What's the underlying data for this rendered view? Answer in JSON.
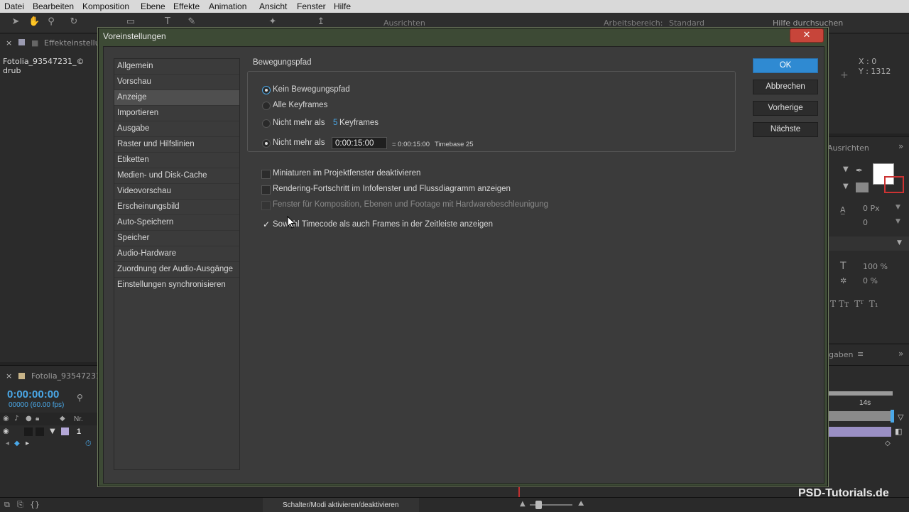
{
  "menubar": {
    "items": [
      "Datei",
      "Bearbeiten",
      "Komposition",
      "Ebene",
      "Effekte",
      "Animation",
      "Ansicht",
      "Fenster",
      "Hilfe"
    ]
  },
  "toolbar": {
    "align_label": "Ausrichten",
    "workspace_label": "Arbeitsbereich:",
    "workspace_value": "Standard",
    "search_placeholder": "Hilfe durchsuchen"
  },
  "background": {
    "effects_tab": "Effekteinstellu",
    "project_file": "Fotolia_93547231_© drub",
    "info_x": "X : 0",
    "info_y": "Y : 1312",
    "align_tab": "Ausrichten",
    "text_values": [
      "0 Px",
      "0",
      "100 %",
      "0 %"
    ],
    "tab_partial": "gaben",
    "timeline_tab": "Fotolia_93547231",
    "timecode": "0:00:00:00",
    "fps": "00000 (60.00 fps)",
    "col_nr": "Nr.",
    "layer_num": "1",
    "ruler_label": "14s",
    "switch_label": "Schalter/Modi aktivieren/deaktivieren",
    "watermark": "PSD-Tutorials.de"
  },
  "dialog": {
    "title": "Voreinstellungen",
    "close_glyph": "✕",
    "sidebar": [
      {
        "label": "Allgemein"
      },
      {
        "label": "Vorschau"
      },
      {
        "label": "Anzeige"
      },
      {
        "label": "Importieren"
      },
      {
        "label": "Ausgabe"
      },
      {
        "label": "Raster und Hilfslinien"
      },
      {
        "label": "Etiketten"
      },
      {
        "label": "Medien- und Disk-Cache"
      },
      {
        "label": "Videovorschau"
      },
      {
        "label": "Erscheinungsbild"
      },
      {
        "label": "Auto-Speichern"
      },
      {
        "label": "Speicher"
      },
      {
        "label": "Audio-Hardware"
      },
      {
        "label": "Zuordnung der Audio-Ausgänge"
      },
      {
        "label": "Einstellungen synchronisieren"
      }
    ],
    "active_index": 2,
    "motion_path": {
      "title": "Bewegungspfad",
      "options": {
        "none": "Kein Bewegungspfad",
        "all": "Alle Keyframes",
        "max_keyframes": "Nicht mehr als",
        "max_time": "Nicht mehr als"
      },
      "keyframe_count": "5",
      "keyframes_label": "Keyframes",
      "timecode_value": "0:00:15:00",
      "timecode_equals": "= 0:00:15:00",
      "timebase": "Timebase 25"
    },
    "checkboxes": [
      {
        "label": "Miniaturen im Projektfenster deaktivieren"
      },
      {
        "label": "Rendering-Fortschritt im Infofenster und Flussdiagramm anzeigen"
      },
      {
        "label": "Fenster für Komposition, Ebenen und Footage mit Hardwarebeschleunigung"
      },
      {
        "label": "Sowohl Timecode als auch Frames in der Zeitleiste anzeigen"
      }
    ],
    "buttons": {
      "ok": "OK",
      "cancel": "Abbrechen",
      "previous": "Vorherige",
      "next": "Nächste"
    }
  }
}
